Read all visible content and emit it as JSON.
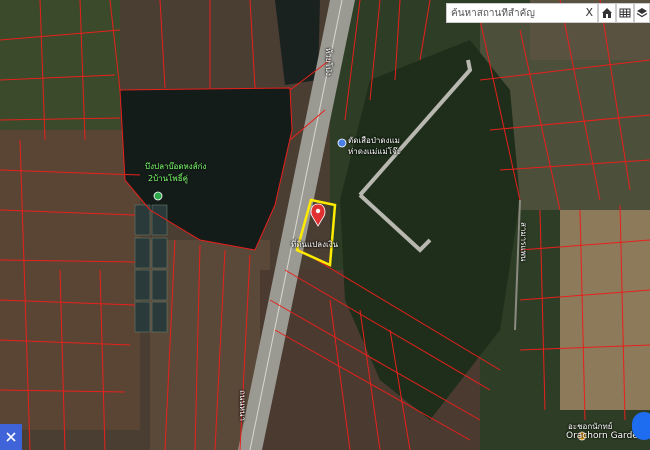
{
  "search": {
    "placeholder": "ค้นหาสถานที่สำคัญ",
    "clear_label": "X"
  },
  "toolbar": {
    "buttons": [
      "home-icon",
      "grid-icon",
      "layers-icon"
    ]
  },
  "map": {
    "labels": {
      "road_top": "ห้วยโป่ง",
      "place_center": "ตัดเสือป่าดงแม",
      "place_center_sub": "ห่าดงแม่แม่โจ๊ะ",
      "pond": "บึงปลาบ๊อดหงส์ก่ง",
      "pond_sub": "2บ้านโพธิ์คู่",
      "pin_label": "ที่ดินแปลงเงิน",
      "road_right": "สามารแพน",
      "road_bottom": "ถนนหนา",
      "garden": "อะชอกนักทย์",
      "garden_sub": "Orachorn Garden"
    },
    "colors": {
      "boundary": "#e8201c",
      "highlight": "#ffeb00",
      "pin": "#e03030",
      "water": "#111a18"
    }
  },
  "controls": {
    "bottom_left_icon": "cross-icon",
    "bottom_right_button": "map-control"
  }
}
